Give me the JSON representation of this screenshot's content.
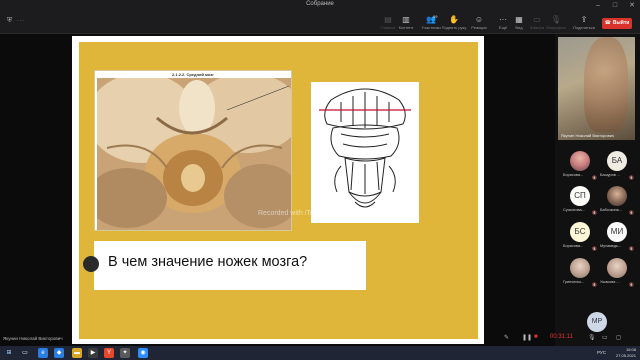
{
  "window": {
    "title": "Собрание",
    "left_label": "···"
  },
  "toolbar": {
    "buttons": [
      {
        "label": "Главное",
        "icon": "main-icon"
      },
      {
        "label": "Контент",
        "icon": "content-icon"
      },
      {
        "label": "Участники",
        "icon": "people-icon",
        "count": "99"
      },
      {
        "label": "Поднять руку",
        "icon": "hand-icon"
      },
      {
        "label": "Реакции",
        "icon": "smile-icon"
      },
      {
        "label": "Ещё",
        "icon": "more-icon"
      },
      {
        "label": "Вид",
        "icon": "view-icon"
      },
      {
        "label": "Камера",
        "icon": "camera-icon"
      },
      {
        "label": "Микрофон",
        "icon": "mic-icon"
      },
      {
        "label": "Поделиться",
        "icon": "share-icon"
      }
    ],
    "leave_label": "Выйти",
    "leave_color": "#d9332b"
  },
  "slide": {
    "photo_caption": "2.1.2.2. Средний мозг",
    "question": "В чем значение ножек мозга?",
    "accent_color": "#e0b63a",
    "watermark": "Recorded with iTop Screen Recorder"
  },
  "stage": {
    "presenter_name": "Якунин Николай Викторович"
  },
  "gallery": {
    "self_name": "Якунин Николай Викторович",
    "participants": [
      {
        "name": "Борисова...",
        "initials": "",
        "style": "photo-pink",
        "muted": true
      },
      {
        "name": "Башуров ...",
        "initials": "БА",
        "style": "init-ba",
        "muted": true
      },
      {
        "name": "Сускопова...",
        "initials": "СП",
        "style": "init-sp",
        "muted": true
      },
      {
        "name": "Бабочкина...",
        "initials": "",
        "style": "photo-dark",
        "muted": true
      },
      {
        "name": "Борисова...",
        "initials": "БС",
        "style": "init-bs",
        "muted": true
      },
      {
        "name": "Мухамедь...",
        "initials": "МИ",
        "style": "init-mi",
        "muted": true
      },
      {
        "name": "Гринченко...",
        "initials": "",
        "style": "photo-light",
        "muted": true
      },
      {
        "name": "Ушакова ...",
        "initials": "",
        "style": "photo-light",
        "muted": true
      }
    ],
    "extra_avatar": "МР"
  },
  "recording": {
    "time": "00:31:11"
  },
  "taskbar": {
    "lang": "РУС",
    "time": "16:08",
    "date": "27.05.2021"
  }
}
